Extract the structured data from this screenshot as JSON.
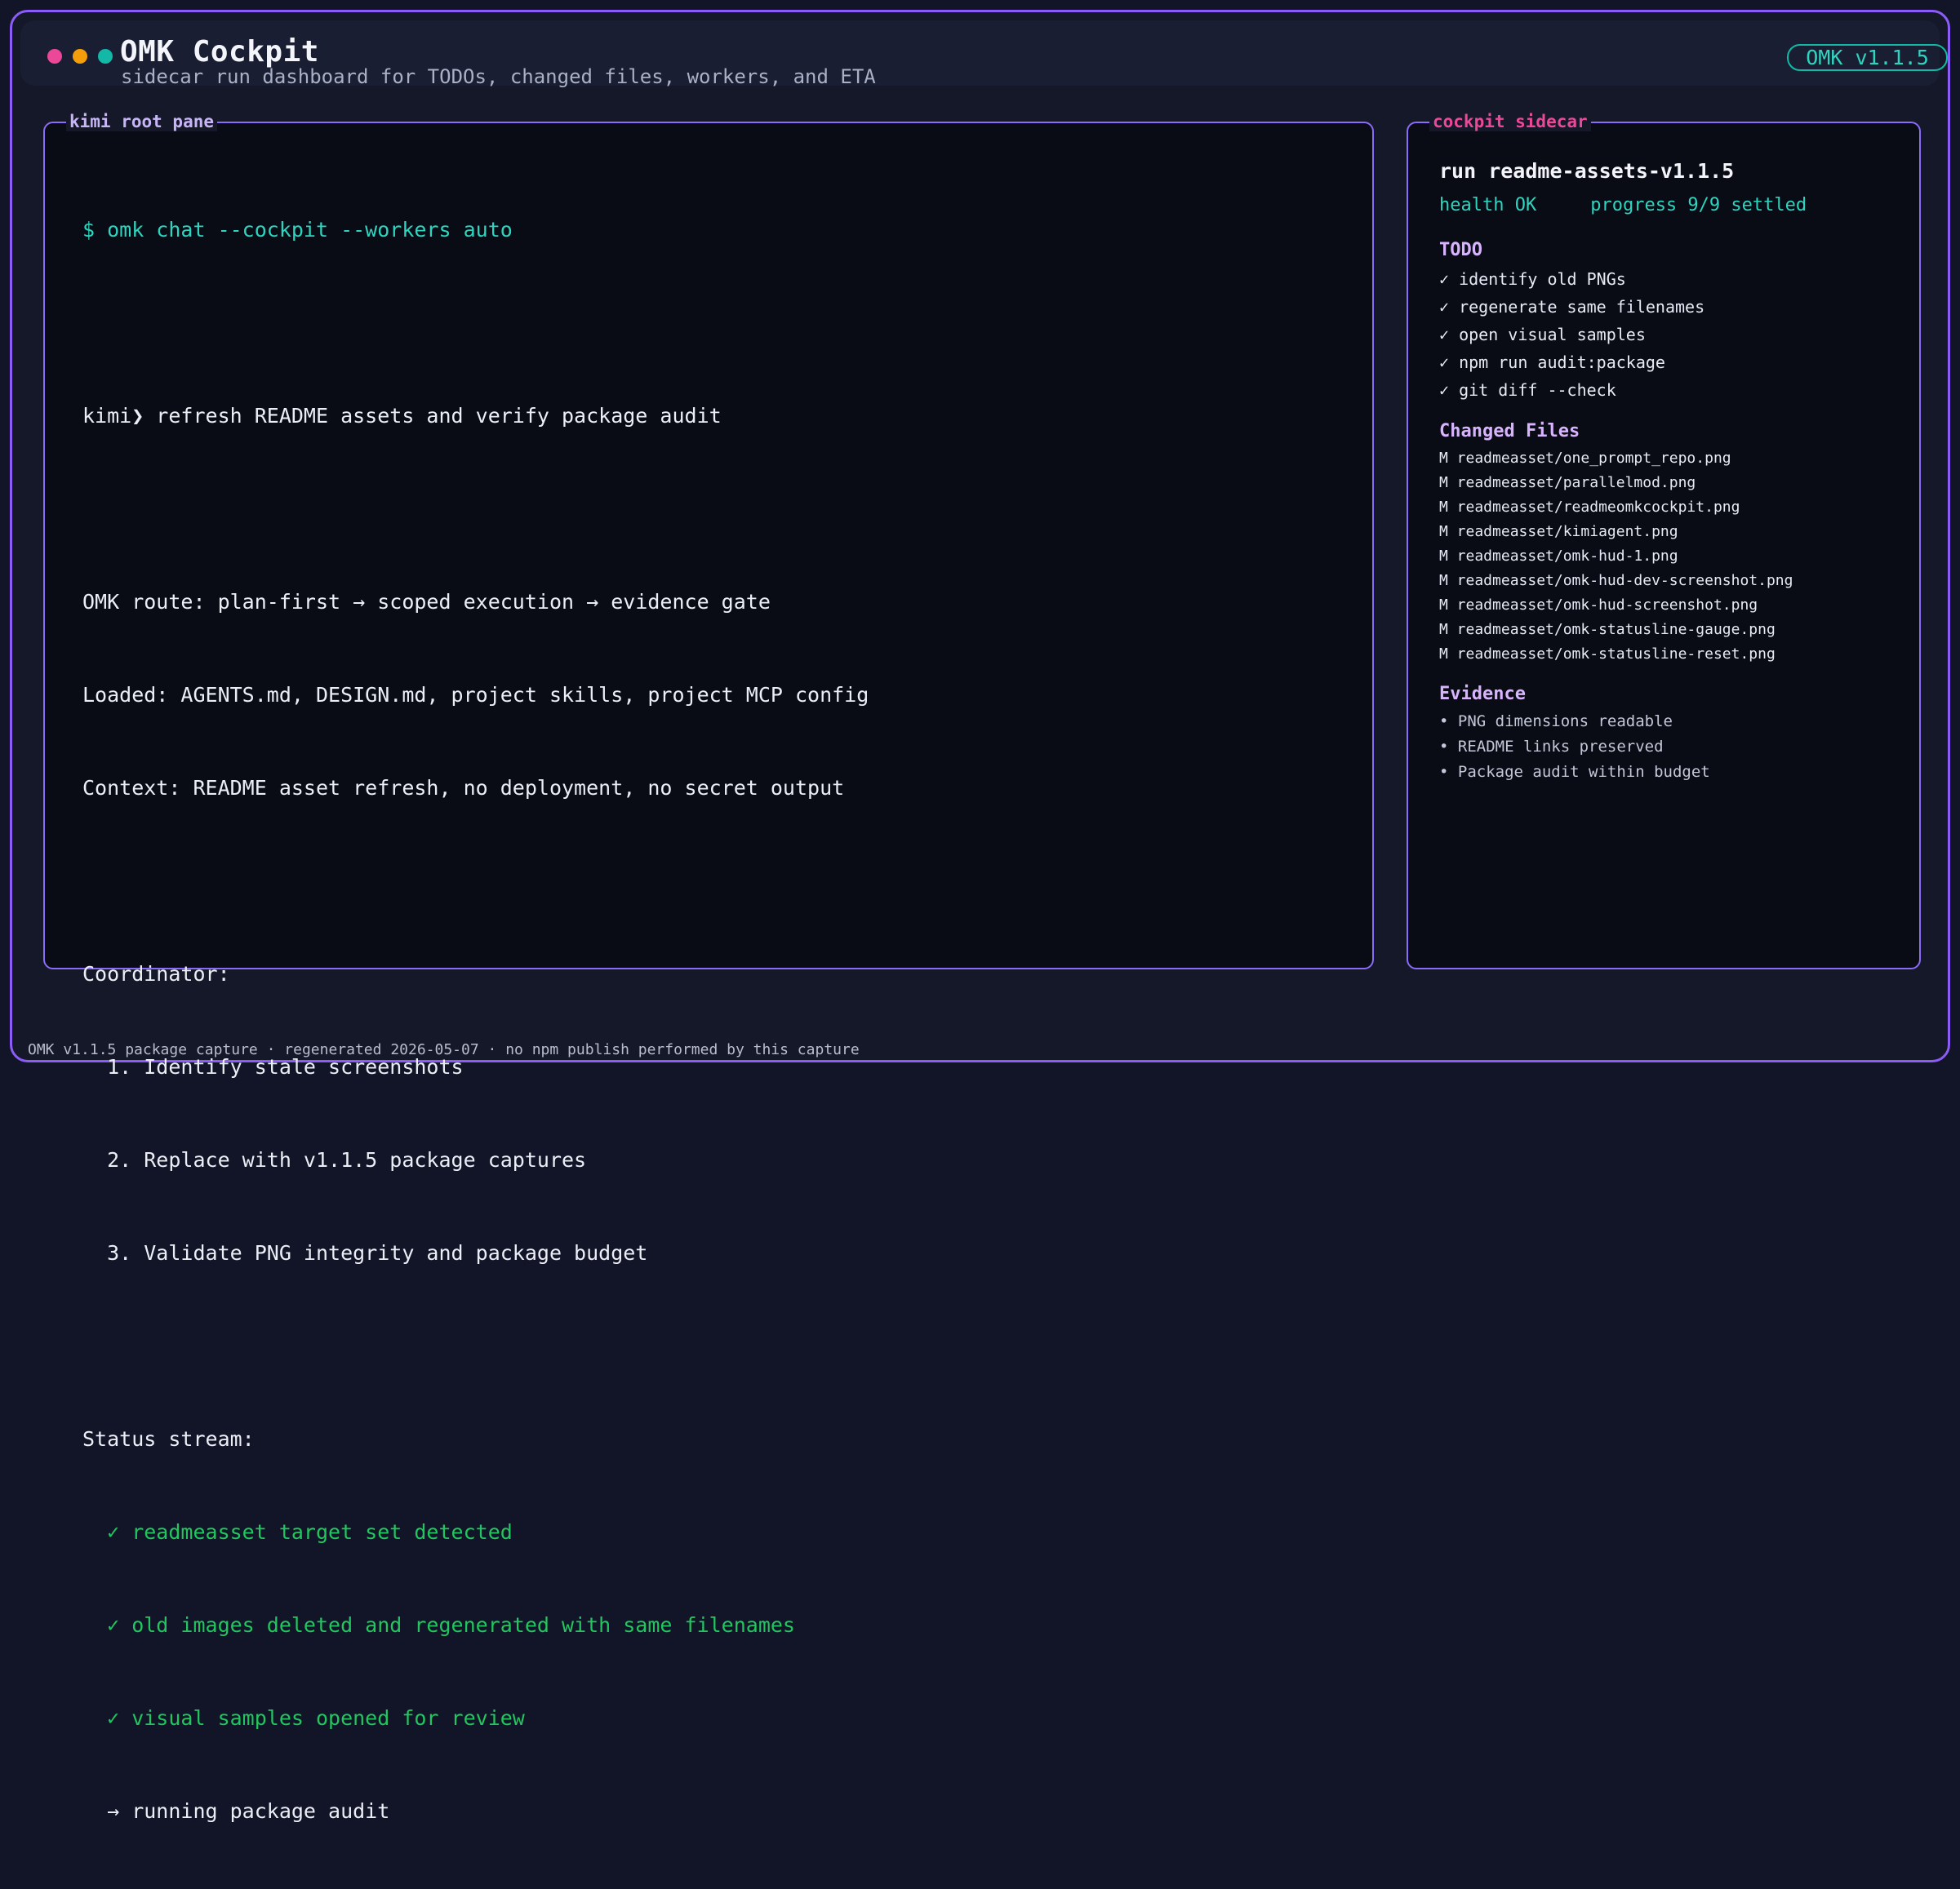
{
  "header": {
    "title": "OMK Cockpit",
    "subtitle": "sidecar run dashboard for TODOs, changed files, workers, and ETA",
    "version": "OMK v1.1.5"
  },
  "left_pane": {
    "label": "kimi root pane",
    "command": "$ omk chat --cockpit --workers auto",
    "prompt": "kimi❯ refresh README assets and verify package audit",
    "route": "OMK route: plan-first → scoped execution → evidence gate",
    "loaded": "Loaded: AGENTS.md, DESIGN.md, project skills, project MCP config",
    "context": "Context: README asset refresh, no deployment, no secret output",
    "coordinator_title": "Coordinator:",
    "coordinator_steps": [
      "  1. Identify stale screenshots",
      "  2. Replace with v1.1.5 package captures",
      "  3. Validate PNG integrity and package budget"
    ],
    "status_title": "Status stream:",
    "status_done": [
      "  ✓ readmeasset target set detected",
      "  ✓ old images deleted and regenerated with same filenames",
      "  ✓ visual samples opened for review"
    ],
    "status_running": "  → running package audit"
  },
  "sidecar": {
    "label": "cockpit sidecar",
    "run_title": "run readme-assets-v1.1.5",
    "health": "health OK",
    "progress": "progress 9/9 settled",
    "todo_title": "TODO",
    "todos": [
      "✓ identify old PNGs",
      "✓ regenerate same filenames",
      "✓ open visual samples",
      "✓ npm run audit:package",
      "✓ git diff --check"
    ],
    "files_title": "Changed Files",
    "files": [
      "M readmeasset/one_prompt_repo.png",
      "M readmeasset/parallelmod.png",
      "M readmeasset/readmeomkcockpit.png",
      "M readmeasset/kimiagent.png",
      "M readmeasset/omk-hud-1.png",
      "M readmeasset/omk-hud-dev-screenshot.png",
      "M readmeasset/omk-hud-screenshot.png",
      "M readmeasset/omk-statusline-gauge.png",
      "M readmeasset/omk-statusline-reset.png"
    ],
    "evidence_title": "Evidence",
    "evidence": [
      "• PNG dimensions readable",
      "• README links preserved",
      "• Package audit within budget"
    ]
  },
  "footer": {
    "text": "OMK v1.1.5 package capture · regenerated 2026-05-07 · no npm publish performed by this capture"
  },
  "colors": {
    "accent_purple": "#8b5cf6",
    "accent_pink": "#ec4899",
    "accent_teal": "#14b8a6",
    "success_green": "#22c55e",
    "background": "#0a0c15"
  }
}
